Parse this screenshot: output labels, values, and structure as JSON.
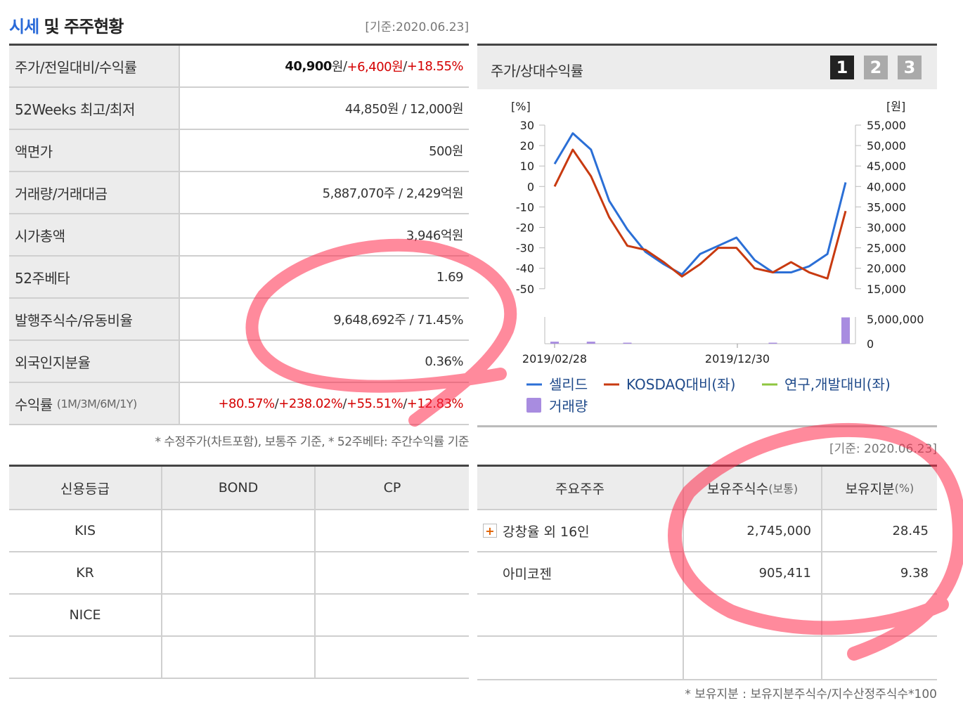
{
  "header": {
    "title_blue": "시세",
    "title_rest": " 및 주주현황",
    "basis": "[기준:2020.06.23]"
  },
  "price_table": {
    "rows": [
      {
        "label": "주가/전일대비/수익률",
        "price": "40,900",
        "price_unit": "원",
        "sep1": " / ",
        "change": "+6,400원",
        "sep2": " / ",
        "rate": "+18.55%"
      },
      {
        "label": "52Weeks 최고/최저",
        "value": "44,850원 / 12,000원"
      },
      {
        "label": "액면가",
        "value": "500원"
      },
      {
        "label": "거래량/거래대금",
        "value": "5,887,070주 / 2,429억원"
      },
      {
        "label": "시가총액",
        "value": "3,946억원"
      },
      {
        "label": "52주베타",
        "value": "1.69"
      },
      {
        "label": "발행주식수/유동비율",
        "value": "9,648,692주 / 71.45%"
      },
      {
        "label": "외국인지분율",
        "value": "0.36%"
      },
      {
        "label": "수익률",
        "label_sub": "(1M/3M/6M/1Y)",
        "r1": "+80.57%",
        "s1": "/ ",
        "r2": "+238.02%",
        "s2": "/ ",
        "r3": "+55.51%",
        "s3": "/ ",
        "r4": "+12.83%"
      }
    ],
    "note": "* 수정주가(차트포함), 보통주 기준, * 52주베타: 주간수익률 기준"
  },
  "chart_panel": {
    "title": "주가/상대수익률",
    "pages": [
      "1",
      "2",
      "3"
    ],
    "active_page": "1"
  },
  "chart_data": {
    "type": "line",
    "left_unit": "[%]",
    "right_unit": "[원]",
    "left_ticks": [
      "30",
      "20",
      "10",
      "0",
      "-10",
      "-20",
      "-30",
      "-40",
      "-50"
    ],
    "right_ticks": [
      "55,000",
      "50,000",
      "45,000",
      "40,000",
      "35,000",
      "30,000",
      "25,000",
      "20,000",
      "15,000"
    ],
    "volume_ticks": [
      "5,000,000",
      "0"
    ],
    "x_labels": [
      "2019/02/28",
      "2019/12/30"
    ],
    "left_range": [
      -50,
      30
    ],
    "series": [
      {
        "name": "셀리드",
        "color": "#2b6fd6",
        "values": [
          11,
          26,
          18,
          -7,
          -21,
          -32,
          -38,
          -43,
          -33,
          -29,
          -25,
          -36,
          -42,
          -42,
          -39,
          -33,
          2
        ]
      },
      {
        "name": "KOSDAQ대비(좌)",
        "color": "#c83a10",
        "values": [
          0,
          18,
          5,
          -15,
          -29,
          -31,
          -37,
          -44,
          -38,
          -30,
          -30,
          -40,
          -42,
          -37,
          -42,
          -45,
          -12
        ]
      },
      {
        "name": "연구,개발대비(좌)",
        "color": "#8ec63f",
        "values": []
      }
    ],
    "volume": {
      "name": "거래량",
      "color": "#a88ce0",
      "max": 5000000,
      "values": [
        400000,
        0,
        400000,
        0,
        200000,
        0,
        0,
        0,
        0,
        0,
        0,
        0,
        200000,
        0,
        0,
        0,
        5200000
      ]
    }
  },
  "credit_table": {
    "headers": [
      "신용등급",
      "BOND",
      "CP"
    ],
    "rows": [
      [
        "KIS",
        "",
        ""
      ],
      [
        "KR",
        "",
        ""
      ],
      [
        "NICE",
        "",
        ""
      ],
      [
        "",
        "",
        ""
      ]
    ]
  },
  "holders": {
    "basis": "[기준: 2020.06.23]",
    "h1": "주요주주",
    "h2": "보유주식수",
    "h2_sub": "(보통)",
    "h3": "보유지분",
    "h3_sub": "(%)",
    "plus_glyph": "+",
    "rows": [
      {
        "name": "강창율 외 16인",
        "shares": "2,745,000",
        "pct": "28.45"
      },
      {
        "name": "아미코젠",
        "shares": "905,411",
        "pct": "9.38"
      }
    ],
    "note": "* 보유지분 : 보유지분주식수/지수산정주식수*100"
  },
  "colors": {
    "accent_blue": "#2a6ad8",
    "positive_red": "#d40000",
    "scribble": "#ff2a4a"
  }
}
